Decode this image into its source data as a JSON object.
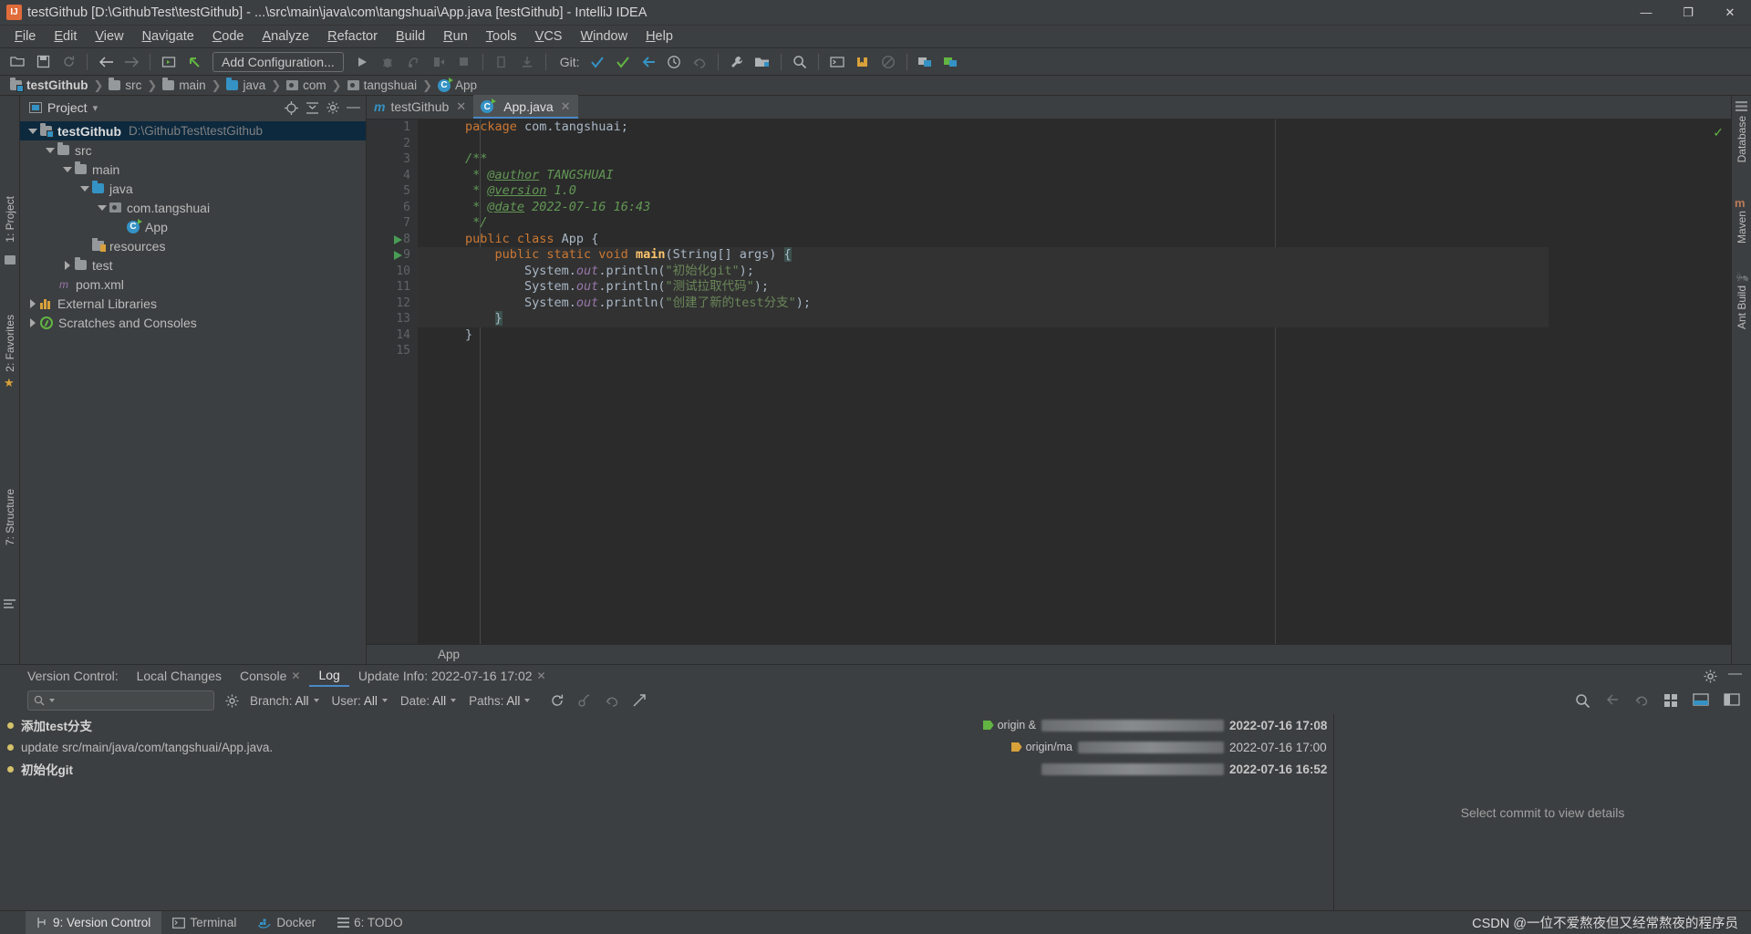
{
  "window": {
    "title": "testGithub [D:\\GithubTest\\testGithub] - ...\\src\\main\\java\\com\\tangshuai\\App.java [testGithub] - IntelliJ IDEA",
    "minimize": "—",
    "maximize": "❐",
    "close": "✕"
  },
  "menubar": {
    "items": [
      "File",
      "Edit",
      "View",
      "Navigate",
      "Code",
      "Analyze",
      "Refactor",
      "Build",
      "Run",
      "Tools",
      "VCS",
      "Window",
      "Help"
    ]
  },
  "toolbar": {
    "add_configuration": "Add Configuration...",
    "git_label": "Git:",
    "icons": [
      "open-folder-icon",
      "save-icon",
      "sync-icon",
      "back-arrow-icon",
      "forward-arrow-icon",
      "build-project-icon",
      "undo-arrow-icon",
      "run-icon",
      "debug-icon",
      "coverage-icon",
      "profiler-icon",
      "stop-icon",
      "structure-icon",
      "install-icon",
      "git-update-icon",
      "git-commit-icon",
      "git-push-icon",
      "git-history-icon",
      "git-revert-icon",
      "settings-wrench-icon",
      "project-structure-icon",
      "search-everywhere-icon",
      "terminal-icon",
      "bookmark-icon",
      "disabled-icon",
      "plugin-icon",
      "plugin2-icon"
    ]
  },
  "breadcrumb": {
    "items": [
      {
        "label": "testGithub",
        "icon": "module-folder-icon"
      },
      {
        "label": "src",
        "icon": "folder-icon"
      },
      {
        "label": "main",
        "icon": "folder-icon"
      },
      {
        "label": "java",
        "icon": "source-folder-icon"
      },
      {
        "label": "com",
        "icon": "package-icon"
      },
      {
        "label": "tangshuai",
        "icon": "package-icon"
      },
      {
        "label": "App",
        "icon": "class-icon"
      }
    ],
    "separator": "❯"
  },
  "left_strip": {
    "project_label": "1: Project",
    "structure_label": "7: Structure",
    "favorites_label": "2: Favorites"
  },
  "right_strip": {
    "database_label": "Database",
    "maven_label": "Maven",
    "ant_label": "Ant Build"
  },
  "project_panel": {
    "title": "Project",
    "dropdown_caret": "▾",
    "header_icons": [
      "locate-icon",
      "collapse-all-icon",
      "settings-gear-icon",
      "hide-icon"
    ],
    "tree": [
      {
        "label": "testGithub",
        "path": "D:\\GithubTest\\testGithub",
        "indent": 0,
        "arrow": "down",
        "icon": "module-folder-icon",
        "selected": true,
        "bold": true
      },
      {
        "label": "src",
        "path": "",
        "indent": 1,
        "arrow": "down",
        "icon": "folder-icon",
        "selected": false,
        "bold": false
      },
      {
        "label": "main",
        "path": "",
        "indent": 2,
        "arrow": "down",
        "icon": "folder-icon",
        "selected": false,
        "bold": false
      },
      {
        "label": "java",
        "path": "",
        "indent": 3,
        "arrow": "down",
        "icon": "source-folder-icon",
        "selected": false,
        "bold": false
      },
      {
        "label": "com.tangshuai",
        "path": "",
        "indent": 4,
        "arrow": "down",
        "icon": "package-icon",
        "selected": false,
        "bold": false
      },
      {
        "label": "App",
        "path": "",
        "indent": 5,
        "arrow": "none",
        "icon": "class-icon",
        "selected": false,
        "bold": false
      },
      {
        "label": "resources",
        "path": "",
        "indent": 3,
        "arrow": "none",
        "icon": "resources-folder-icon",
        "selected": false,
        "bold": false
      },
      {
        "label": "test",
        "path": "",
        "indent": 2,
        "arrow": "right",
        "icon": "folder-icon",
        "selected": false,
        "bold": false
      },
      {
        "label": "pom.xml",
        "path": "",
        "indent": 1,
        "arrow": "none",
        "icon": "maven-xml-icon",
        "selected": false,
        "bold": false
      },
      {
        "label": "External Libraries",
        "path": "",
        "indent": 0,
        "arrow": "right",
        "icon": "library-icon",
        "selected": false,
        "bold": false
      },
      {
        "label": "Scratches and Consoles",
        "path": "",
        "indent": 0,
        "arrow": "right",
        "icon": "scratch-icon",
        "selected": false,
        "bold": false
      }
    ]
  },
  "editor": {
    "tabs": [
      {
        "label": "testGithub",
        "icon": "maven-icon",
        "active": false,
        "close": "✕"
      },
      {
        "label": "App.java",
        "icon": "class-icon",
        "active": true,
        "close": "✕"
      }
    ],
    "breadcrumb_bottom": "App",
    "line_numbers": [
      "1",
      "2",
      "3",
      "4",
      "5",
      "6",
      "7",
      "8",
      "9",
      "10",
      "11",
      "12",
      "13",
      "14",
      "15"
    ],
    "code_lines": [
      {
        "n": 1,
        "tokens": [
          {
            "t": "package ",
            "c": "kw"
          },
          {
            "t": "com.tangshuai;",
            "c": "id"
          }
        ]
      },
      {
        "n": 2,
        "tokens": []
      },
      {
        "n": 3,
        "tokens": [
          {
            "t": "/**",
            "c": "cmt"
          }
        ]
      },
      {
        "n": 4,
        "tokens": [
          {
            "t": " * ",
            "c": "cmt"
          },
          {
            "t": "@author",
            "c": "cmt-u"
          },
          {
            "t": " TANGSHUAI",
            "c": "cmt"
          }
        ]
      },
      {
        "n": 5,
        "tokens": [
          {
            "t": " * ",
            "c": "cmt"
          },
          {
            "t": "@version",
            "c": "cmt-u"
          },
          {
            "t": " 1.0",
            "c": "cmt"
          }
        ]
      },
      {
        "n": 6,
        "tokens": [
          {
            "t": " * ",
            "c": "cmt"
          },
          {
            "t": "@date",
            "c": "cmt-u"
          },
          {
            "t": " 2022-07-16 16:43",
            "c": "cmt"
          }
        ]
      },
      {
        "n": 7,
        "tokens": [
          {
            "t": " */",
            "c": "cmt"
          }
        ]
      },
      {
        "n": 8,
        "tokens": [
          {
            "t": "public class ",
            "c": "kw"
          },
          {
            "t": "App ",
            "c": "cls"
          },
          {
            "t": "{",
            "c": "id"
          }
        ]
      },
      {
        "n": 9,
        "tokens": [
          {
            "t": "    public static void ",
            "c": "kw"
          },
          {
            "t": "main",
            "c": "fn"
          },
          {
            "t": "(String[] args) ",
            "c": "id"
          },
          {
            "t": "{",
            "c": "brace"
          }
        ]
      },
      {
        "n": 10,
        "tokens": [
          {
            "t": "        System.",
            "c": "id"
          },
          {
            "t": "out",
            "c": "fld"
          },
          {
            "t": ".println(",
            "c": "id"
          },
          {
            "t": "\"初始化git\"",
            "c": "str"
          },
          {
            "t": ");",
            "c": "id"
          }
        ]
      },
      {
        "n": 11,
        "tokens": [
          {
            "t": "        System.",
            "c": "id"
          },
          {
            "t": "out",
            "c": "fld"
          },
          {
            "t": ".println(",
            "c": "id"
          },
          {
            "t": "\"测试拉取代码\"",
            "c": "str"
          },
          {
            "t": ");",
            "c": "id"
          }
        ]
      },
      {
        "n": 12,
        "tokens": [
          {
            "t": "        System.",
            "c": "id"
          },
          {
            "t": "out",
            "c": "fld"
          },
          {
            "t": ".println(",
            "c": "id"
          },
          {
            "t": "\"创建了新的test分支\"",
            "c": "str"
          },
          {
            "t": ");",
            "c": "id"
          }
        ]
      },
      {
        "n": 13,
        "tokens": [
          {
            "t": "    ",
            "c": "id"
          },
          {
            "t": "}",
            "c": "brace"
          }
        ]
      },
      {
        "n": 14,
        "tokens": [
          {
            "t": "}",
            "c": "id"
          }
        ]
      },
      {
        "n": 15,
        "tokens": []
      }
    ],
    "run_markers": [
      8,
      9
    ],
    "inspection_status": "✓"
  },
  "vcs": {
    "panel_label": "Version Control:",
    "tabs": [
      {
        "label": "Local Changes",
        "active": false,
        "closable": false
      },
      {
        "label": "Console",
        "active": false,
        "closable": true,
        "close": "✕"
      },
      {
        "label": "Log",
        "active": true,
        "closable": false
      },
      {
        "label": "Update Info: 2022-07-16 17:02",
        "active": false,
        "closable": true,
        "close": "✕"
      }
    ],
    "panel_icons": [
      "settings-gear-icon",
      "hide-panel-icon"
    ],
    "search_placeholder": "",
    "search_value": "",
    "filters": [
      {
        "name": "Branch:",
        "value": "All"
      },
      {
        "name": "User:",
        "value": "All"
      },
      {
        "name": "Date:",
        "value": "All"
      },
      {
        "name": "Paths:",
        "value": "All"
      }
    ],
    "toolbar_icons": [
      "refresh-icon",
      "cherry-pick-icon",
      "revert-icon",
      "go-to-hash-icon",
      "search-icon",
      "collapse-icon",
      "expand-icon",
      "show-details-icon",
      "layout-icon",
      "diff-icon",
      "expand-all-icon",
      "collapse-all-icon"
    ],
    "commits": [
      {
        "message": "添加test分支",
        "bold": true,
        "date": "2022-07-16 17:08",
        "date_bold": true,
        "tags": [
          {
            "label": "origin &",
            "color": "green"
          }
        ],
        "blurred": true
      },
      {
        "message": "update src/main/java/com/tangshuai/App.java.",
        "bold": false,
        "date": "2022-07-16 17:00",
        "date_bold": false,
        "tags": [
          {
            "label": "origin/ma",
            "color": "yellow"
          }
        ],
        "blurred": true
      },
      {
        "message": "初始化git",
        "bold": true,
        "date": "2022-07-16 16:52",
        "date_bold": true,
        "tags": [],
        "blurred": true
      }
    ],
    "details_placeholder": "Select commit to view details"
  },
  "statusbar": {
    "items": [
      {
        "label": "9: Version Control",
        "icon": "vcs-icon",
        "active": true
      },
      {
        "label": "Terminal",
        "icon": "terminal-icon",
        "active": false
      },
      {
        "label": "Docker",
        "icon": "docker-icon",
        "active": false
      },
      {
        "label": "6: TODO",
        "icon": "todo-icon",
        "active": false
      }
    ],
    "watermark": "CSDN @一位不爱熬夜但又经常熬夜的程序员"
  },
  "colors": {
    "accent": "#4a88c7",
    "panel_bg": "#3c3f41",
    "editor_bg": "#2b2b2b",
    "selection": "#0d293e",
    "keyword": "#cc7832",
    "string": "#6a8759",
    "comment": "#629755",
    "field": "#9876aa",
    "method": "#ffc66d",
    "green": "#62b543",
    "yellow": "#d8a13a"
  }
}
